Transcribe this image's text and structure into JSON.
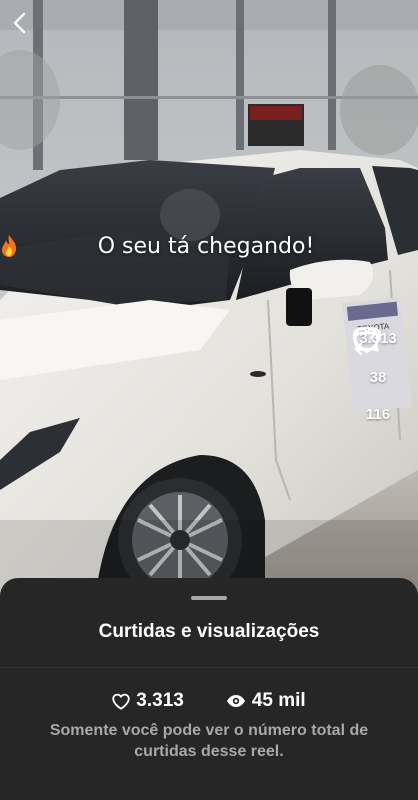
{
  "reel": {
    "caption": "O seu tá chegando!",
    "caption_emoji": "fire-icon",
    "actions": {
      "likes": "3.313",
      "comments": "38",
      "reposts": "116"
    }
  },
  "sheet": {
    "title": "Curtidas e visualizações",
    "likes": "3.313",
    "views": "45 mil",
    "note": "Somente você pode ver o número total de curtidas desse reel."
  },
  "icons": {
    "back": "chevron-left-icon",
    "like": "heart-icon",
    "comment": "comment-icon",
    "repost": "repost-icon",
    "views": "eye-icon"
  },
  "colors": {
    "sheet_bg": "#262626",
    "muted_text": "#a8a8a8",
    "car_body": "#ecebe8"
  }
}
